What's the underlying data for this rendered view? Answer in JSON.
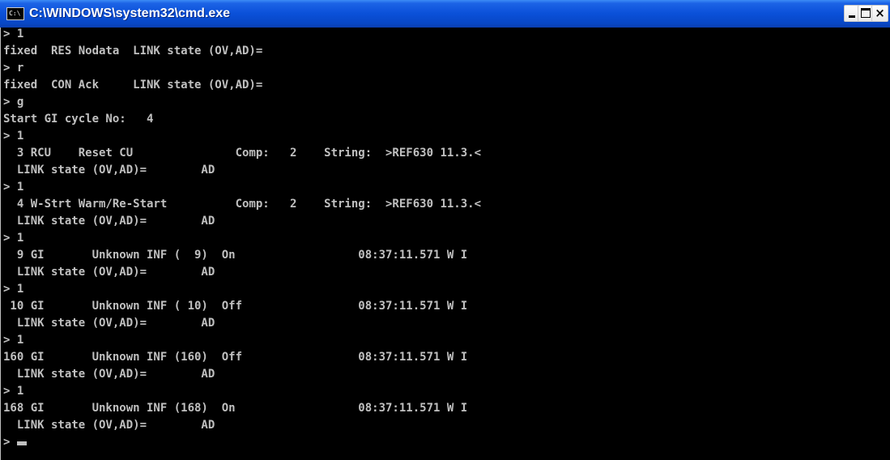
{
  "window": {
    "title": "C:\\WINDOWS\\system32\\cmd.exe",
    "icon": "cmd-icon",
    "controls": {
      "minimize": "minimize-icon",
      "maximize": "maximize-icon",
      "close": "×"
    }
  },
  "console": {
    "lines": [
      "> 1",
      "fixed  RES Nodata  LINK state (OV,AD)=",
      "> r",
      "fixed  CON Ack     LINK state (OV,AD)=",
      "> g",
      "Start GI cycle No:   4",
      "> 1",
      "  3 RCU    Reset CU               Comp:   2    String:  >REF630 11.3.<",
      "  LINK state (OV,AD)=        AD",
      "> 1",
      "  4 W-Strt Warm/Re-Start          Comp:   2    String:  >REF630 11.3.<",
      "  LINK state (OV,AD)=        AD",
      "> 1",
      "  9 GI       Unknown INF (  9)  On                  08:37:11.571 W I",
      "  LINK state (OV,AD)=        AD",
      "> 1",
      " 10 GI       Unknown INF ( 10)  Off                 08:37:11.571 W I",
      "  LINK state (OV,AD)=        AD",
      "> 1",
      "160 GI       Unknown INF (160)  Off                 08:37:11.571 W I",
      "  LINK state (OV,AD)=        AD",
      "> 1",
      "168 GI       Unknown INF (168)  On                  08:37:11.571 W I",
      "  LINK state (OV,AD)=        AD",
      ">"
    ]
  },
  "colors": {
    "title_bar": "#0a50d8",
    "console_background": "#000000",
    "console_text": "#c0c0c0"
  }
}
